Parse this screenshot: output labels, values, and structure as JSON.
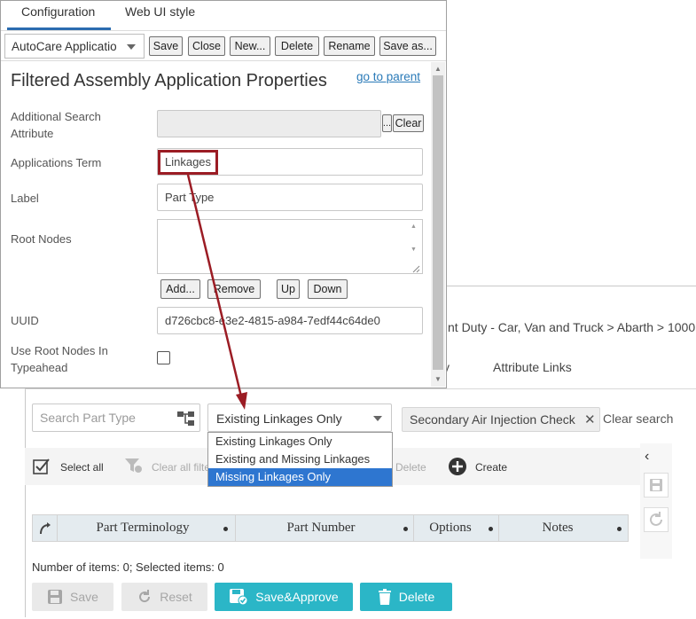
{
  "background": {
    "breadcrumb": "nt Duty - Car, Van and Truck > Abarth > 1000",
    "tab_attribute_links": "Attribute Links",
    "tab_partial": "y",
    "search": {
      "placeholder": "Search Part Type",
      "filter_value": "Existing Linkages Only",
      "chip": "Secondary Air Injection Check",
      "clear_search": "Clear search"
    },
    "filter_options": [
      "Existing Linkages Only",
      "Existing and Missing Linkages",
      "Missing Linkages Only"
    ],
    "toolbar": {
      "select_all": "Select all",
      "clear_all_filters": "Clear all filte",
      "delete": "Delete",
      "create": "Create"
    },
    "grid": {
      "columns": [
        "Part Terminology",
        "Part Number",
        "Options",
        "Notes"
      ],
      "footer": "Number of items: 0; Selected items: 0"
    },
    "buttons": {
      "save": "Save",
      "reset": "Reset",
      "save_approve": "Save&Approve",
      "delete": "Delete"
    }
  },
  "dialog": {
    "tabs": [
      "Configuration",
      "Web UI style"
    ],
    "config_select": "AutoCare Applicatio",
    "top_buttons": {
      "save": "Save",
      "close": "Close",
      "new": "New...",
      "delete": "Delete",
      "rename": "Rename",
      "save_as": "Save as..."
    },
    "title": "Filtered Assembly Application Properties",
    "go_to_parent": "go to parent",
    "fields": {
      "additional_search_label": "Additional Search Attribute",
      "browse": "...",
      "clear": "Clear",
      "applications_term_label": "Applications Term",
      "applications_term_value": "Linkages",
      "label_label": "Label",
      "label_value": "Part Type",
      "root_nodes_label": "Root Nodes",
      "add": "Add...",
      "remove": "Remove",
      "up": "Up",
      "down": "Down",
      "uuid_label": "UUID",
      "uuid_value": "d726cbc8-e3e2-4815-a984-7edf44c64de0",
      "use_root_nodes_label": "Use Root Nodes In Typeahead"
    }
  },
  "colors": {
    "teal": "#2bb6c7",
    "highlight_red": "#9b1c24",
    "selected_option": "#2e76d0",
    "tab_underline": "#2b6cb0",
    "link": "#2a7ab8"
  }
}
